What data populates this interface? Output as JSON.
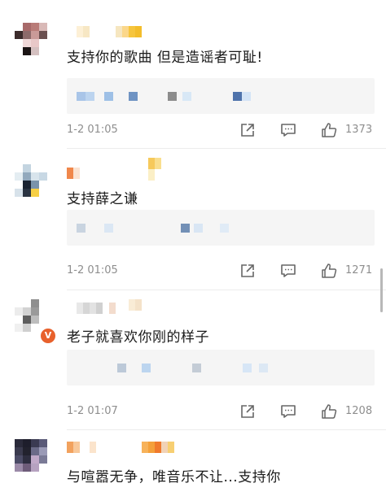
{
  "comments": [
    {
      "text": "支持你的歌曲 但是造谣者可耻!",
      "time": "1-2 01:05",
      "likes": "1373"
    },
    {
      "text": "支持薛之谦",
      "time": "1-2 01:05",
      "likes": "1271"
    },
    {
      "text": "老子就喜欢你刚的样子",
      "time": "1-2 01:07",
      "likes": "1208"
    },
    {
      "text": "与喧嚣无争，唯音乐不让...支持你"
    }
  ],
  "icons": {
    "share": "share-icon",
    "comment": "comment-icon",
    "like": "thumbs-up-icon",
    "verified": "verified-badge-icon"
  },
  "colors": {
    "text": "#1a1a1a",
    "meta": "#8e8e8e",
    "reply_bg": "#f5f5f5",
    "verified_badge": "#e8612c"
  }
}
